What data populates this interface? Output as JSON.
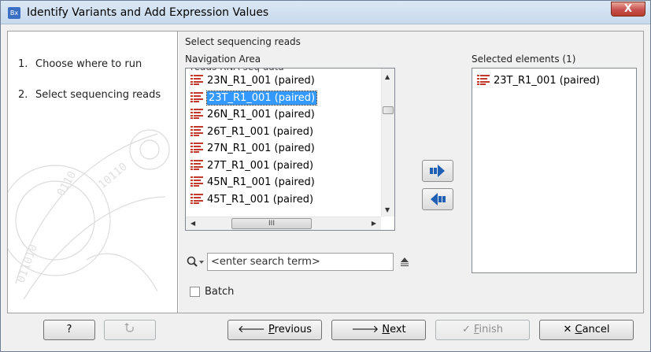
{
  "window": {
    "app_icon_text": "Bx",
    "title": "Identify Variants and Add Expression Values",
    "close_symbol": "X"
  },
  "steps": [
    {
      "num": "1.",
      "label": "Choose where to run"
    },
    {
      "num": "2.",
      "label": "Select sequencing reads"
    }
  ],
  "main": {
    "section_title": "Select sequencing reads",
    "nav_label": "Navigation Area",
    "selected_label": "Selected elements (1)",
    "folder_partial": "reads RNA-seq data",
    "nav_items": [
      {
        "label": "23N_R1_001 (paired)",
        "selected": false
      },
      {
        "label": "23T_R1_001 (paired)",
        "selected": true
      },
      {
        "label": "26N_R1_001 (paired)",
        "selected": false
      },
      {
        "label": "26T_R1_001 (paired)",
        "selected": false
      },
      {
        "label": "27N_R1_001 (paired)",
        "selected": false
      },
      {
        "label": "27T_R1_001 (paired)",
        "selected": false
      },
      {
        "label": "45N_R1_001 (paired)",
        "selected": false
      },
      {
        "label": "45T_R1_001 (paired)",
        "selected": false
      }
    ],
    "selected_items": [
      {
        "label": "23T_R1_001 (paired)"
      }
    ],
    "hscroll_grip": "III",
    "search_placeholder": "<enter search term>",
    "batch_label": "Batch",
    "batch_checked": false
  },
  "buttons": {
    "help": "?",
    "previous_pre": "",
    "previous_ul": "P",
    "previous_post": "revious",
    "next_ul": "N",
    "next_post": "ext",
    "finish_ul": "F",
    "finish_post": "inish",
    "cancel_ul": "C",
    "cancel_post": "ancel"
  },
  "colors": {
    "selection": "#3399ff",
    "seq_icon": "#c0392b",
    "move_arrow": "#1f5fb4"
  }
}
